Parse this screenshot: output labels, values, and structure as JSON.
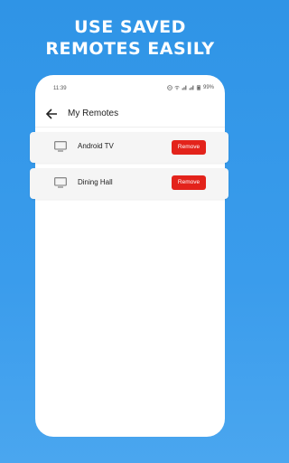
{
  "promo": {
    "line1": "USE SAVED",
    "line2": "REMOTES EASILY"
  },
  "status_bar": {
    "time": "11:39",
    "battery": "99%"
  },
  "app_bar": {
    "title": "My Remotes",
    "back_icon": "arrow-left-icon"
  },
  "remotes": [
    {
      "name": "Android TV",
      "icon": "tv-icon",
      "action_label": "Remove"
    },
    {
      "name": "Dining Hall",
      "icon": "tv-icon",
      "action_label": "Remove"
    }
  ],
  "colors": {
    "background": "#3a9cec",
    "remove_button": "#e3231b",
    "card": "#f5f5f5"
  }
}
